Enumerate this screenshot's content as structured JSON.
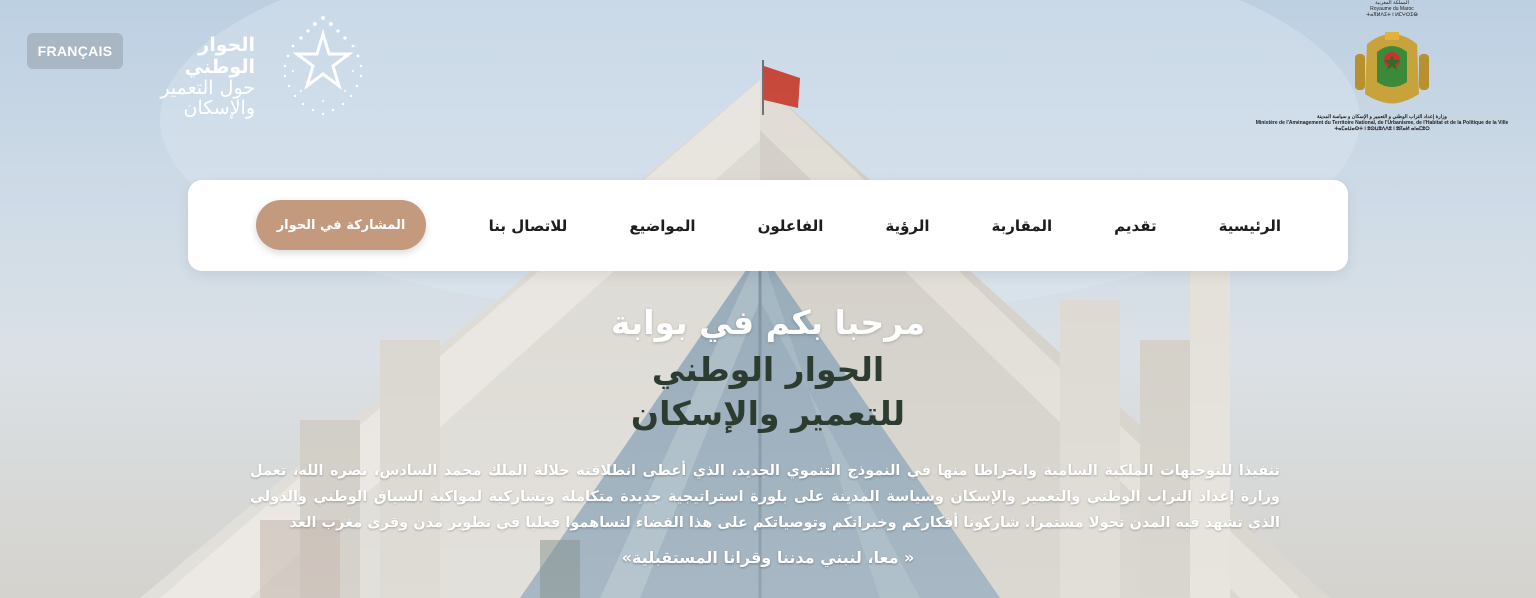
{
  "lang_button": "FRANÇAIS",
  "brand": {
    "line1": "الحوار الوطني",
    "line2": "حول التعمير",
    "line3": "والإسكان"
  },
  "ministry": {
    "top_ar": "المملكة المغربية",
    "top_fr": "Royaume du Maroc",
    "top_tf": "ⵜⴰⴳⵍⴷⵉⵜ ⵏ ⵍⵎⵖⵔⵉⴱ",
    "name_ar": "وزارة إعداد التراب الوطني و التعمير و الإسكان و سياسة المدينة",
    "name_fr": "Ministère de l'Aménagement du Territoire National, de l'Urbanisme, de l'Habitat et de la Politique de la Ville",
    "name_tf": "ⵜⴰⵎⴰⵡⴰⵙⵜ ⵏ ⵓⵙⵡⵓⴷⴷⵓ ⵏ ⵓⴽⴰⵍ ⴰⵏⴰⵎⵓⵔ"
  },
  "nav": {
    "items": [
      "الرئيسية",
      "تقديم",
      "المقاربة",
      "الرؤية",
      "الفاعلون",
      "المواضيع",
      "للاتصال بنا"
    ],
    "cta": "المشاركة في الحوار"
  },
  "hero": {
    "welcome": "مرحبا بكم في بوابة",
    "title_line2": "الحوار الوطني",
    "title_line3": "للتعمير والإسكان",
    "paragraph": "تنفيذا للتوجيهات الملكية السامية وانخراطا منها في النموذج التنموي الجديد، الذي أعطى انطلاقته جلالة الملك محمد السادس، نصره الله، تعمل وزارة إعداد التراب الوطني والتعمير والإسكان وسياسة المدينة على بلورة استراتيجية جديدة متكاملة وتشاركية لمواكبة السياق الوطني والدولي الذي تشهد فيه المدن تحولا مستمرا. شاركونا أفكاركم وخبراتكم وتوصياتكم على هذا الفضاء لتساهموا فعليا في تطوير مدن وقرى مغرب الغد",
    "slogan": "« معا، لنبني مدننا وقرانا المستقبلية»"
  }
}
